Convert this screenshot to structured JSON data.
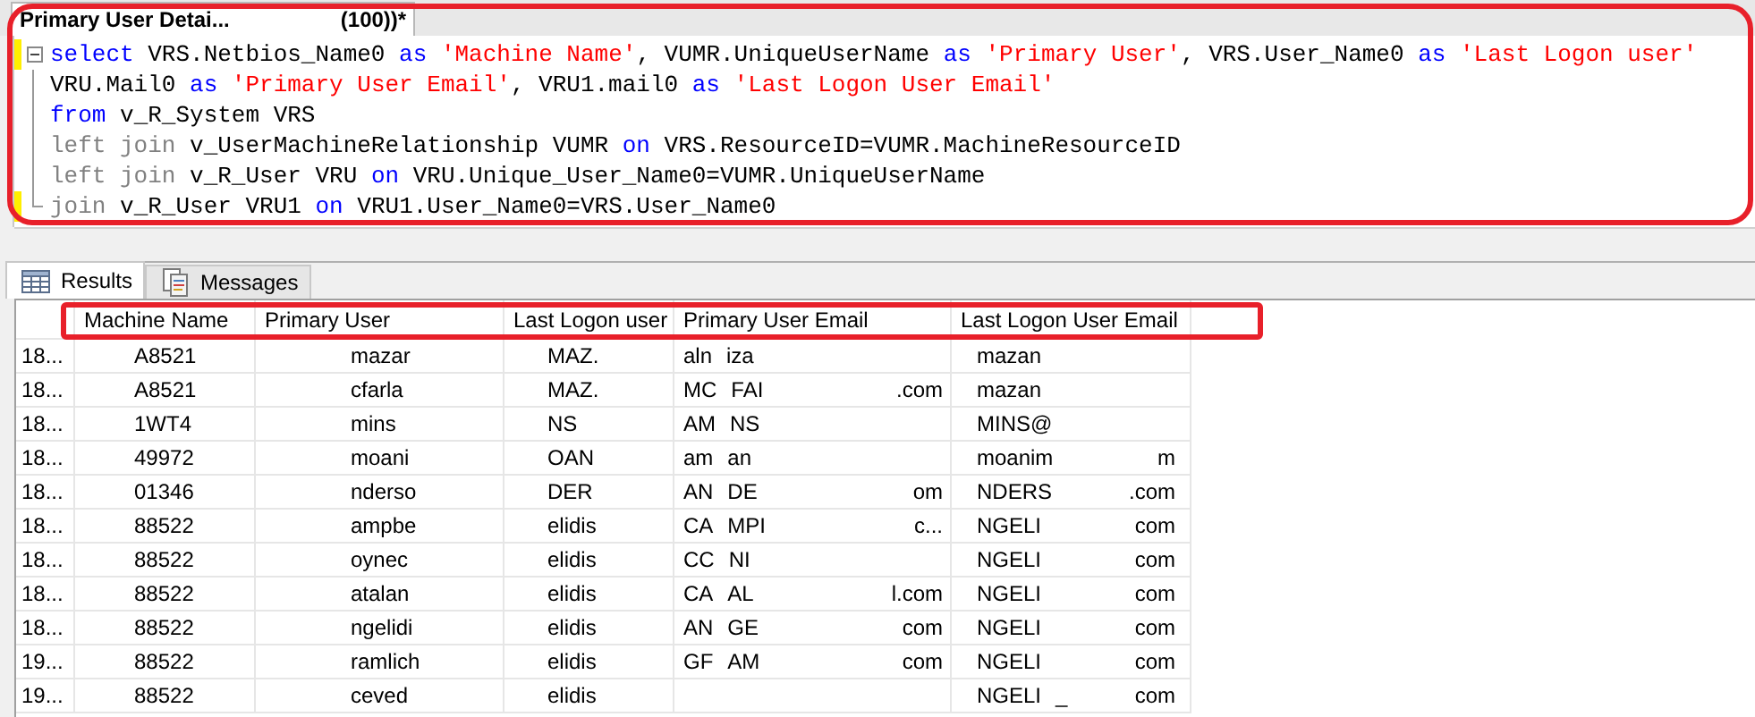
{
  "editor_tab": {
    "title": "Primary User Detai...",
    "suffix": "(100))*",
    "selected": true
  },
  "editor": {
    "lines": [
      {
        "changed": true,
        "tokens": [
          {
            "kind": "keyword",
            "text": "select"
          },
          {
            "kind": "plain",
            "text": " VRS.Netbios_Name0 "
          },
          {
            "kind": "keyword",
            "text": "as"
          },
          {
            "kind": "string",
            "text": " 'Machine Name'"
          },
          {
            "kind": "plain",
            "text": ", VUMR.UniqueUserName "
          },
          {
            "kind": "keyword",
            "text": "as"
          },
          {
            "kind": "string",
            "text": " 'Primary User'"
          },
          {
            "kind": "plain",
            "text": ", VRS.User_Name0 "
          },
          {
            "kind": "keyword",
            "text": "as"
          },
          {
            "kind": "string",
            "text": " 'Last Logon user'"
          }
        ]
      },
      {
        "changed": false,
        "tokens": [
          {
            "kind": "plain",
            "text": "VRU.Mail0 "
          },
          {
            "kind": "keyword",
            "text": "as"
          },
          {
            "kind": "string",
            "text": " 'Primary User Email'"
          },
          {
            "kind": "plain",
            "text": ", VRU1.mail0 "
          },
          {
            "kind": "keyword",
            "text": "as"
          },
          {
            "kind": "string",
            "text": " 'Last Logon User Email'"
          }
        ]
      },
      {
        "changed": false,
        "tokens": [
          {
            "kind": "keyword",
            "text": "from"
          },
          {
            "kind": "plain",
            "text": " v_R_System VRS"
          }
        ]
      },
      {
        "changed": false,
        "tokens": [
          {
            "kind": "operator",
            "text": "left join"
          },
          {
            "kind": "plain",
            "text": " v_UserMachineRelationship VUMR "
          },
          {
            "kind": "keyword",
            "text": "on"
          },
          {
            "kind": "plain",
            "text": " VRS.ResourceID=VUMR.MachineResourceID"
          }
        ]
      },
      {
        "changed": false,
        "tokens": [
          {
            "kind": "operator",
            "text": "left join"
          },
          {
            "kind": "plain",
            "text": " v_R_User VRU "
          },
          {
            "kind": "keyword",
            "text": "on"
          },
          {
            "kind": "plain",
            "text": " VRU.Unique_User_Name0=VUMR.UniqueUserName"
          }
        ]
      },
      {
        "changed": true,
        "tokens": [
          {
            "kind": "operator",
            "text": "join"
          },
          {
            "kind": "plain",
            "text": " v_R_User VRU1 "
          },
          {
            "kind": "keyword",
            "text": "on"
          },
          {
            "kind": "plain",
            "text": " VRU1.User_Name0=VRS.User_Name0"
          }
        ]
      }
    ]
  },
  "result_tabs": [
    {
      "label": "Results",
      "kind": "grid",
      "selected": true
    },
    {
      "label": "Messages",
      "kind": "messages",
      "selected": false
    }
  ],
  "grid": {
    "columns": [
      "Machine Name",
      "Primary User",
      "Last Logon user",
      "Primary User Email",
      "Last Logon User Email"
    ],
    "rows": [
      {
        "row_header": "18...",
        "cells": [
          {
            "parts": [
              "A8521"
            ]
          },
          {
            "parts": [
              "mazar"
            ]
          },
          {
            "parts": [
              "MAZ."
            ]
          },
          {
            "parts": [
              "aln",
              "iza"
            ]
          },
          {
            "parts": [
              "mazan"
            ]
          }
        ]
      },
      {
        "row_header": "18...",
        "cells": [
          {
            "parts": [
              "A8521"
            ]
          },
          {
            "parts": [
              "cfarla"
            ]
          },
          {
            "parts": [
              "MAZ."
            ]
          },
          {
            "parts": [
              "MC",
              "FAI"
            ],
            "tail": ".com"
          },
          {
            "parts": [
              "mazan"
            ]
          }
        ]
      },
      {
        "row_header": "18...",
        "cells": [
          {
            "parts": [
              "1WT4"
            ]
          },
          {
            "parts": [
              "mins"
            ]
          },
          {
            "parts": [
              "NS"
            ]
          },
          {
            "parts": [
              "AM",
              "NS"
            ]
          },
          {
            "parts": [
              "MINS@"
            ]
          }
        ]
      },
      {
        "row_header": "18...",
        "cells": [
          {
            "parts": [
              "49972"
            ]
          },
          {
            "parts": [
              "moani"
            ]
          },
          {
            "parts": [
              "OAN"
            ]
          },
          {
            "parts": [
              "am",
              "an"
            ]
          },
          {
            "parts": [
              "moanim"
            ],
            "tail": "m"
          }
        ]
      },
      {
        "row_header": "18...",
        "cells": [
          {
            "parts": [
              "01346"
            ]
          },
          {
            "parts": [
              "nderso"
            ]
          },
          {
            "parts": [
              "DER"
            ]
          },
          {
            "parts": [
              "AN",
              "DE"
            ],
            "tail": "om"
          },
          {
            "parts": [
              "NDERS"
            ],
            "tail": ".com"
          }
        ]
      },
      {
        "row_header": "18...",
        "cells": [
          {
            "parts": [
              "88522"
            ]
          },
          {
            "parts": [
              "ampbe"
            ]
          },
          {
            "parts": [
              "elidis"
            ]
          },
          {
            "parts": [
              "CA",
              "MPI"
            ],
            "tail": "c..."
          },
          {
            "parts": [
              "NGELI"
            ],
            "tail": "com"
          }
        ]
      },
      {
        "row_header": "18...",
        "cells": [
          {
            "parts": [
              "88522"
            ]
          },
          {
            "parts": [
              "oynec"
            ]
          },
          {
            "parts": [
              "elidis"
            ]
          },
          {
            "parts": [
              "CC",
              "NI"
            ]
          },
          {
            "parts": [
              "NGELI"
            ],
            "tail": "com"
          }
        ]
      },
      {
        "row_header": "18...",
        "cells": [
          {
            "parts": [
              "88522"
            ]
          },
          {
            "parts": [
              "atalan"
            ]
          },
          {
            "parts": [
              "elidis"
            ]
          },
          {
            "parts": [
              "CA",
              "AL"
            ],
            "tail": "l.com"
          },
          {
            "parts": [
              "NGELI"
            ],
            "tail": "com"
          }
        ]
      },
      {
        "row_header": "18...",
        "cells": [
          {
            "parts": [
              "88522"
            ]
          },
          {
            "parts": [
              "ngelidi"
            ]
          },
          {
            "parts": [
              "elidis"
            ]
          },
          {
            "parts": [
              "AN",
              "GE"
            ],
            "tail": "com"
          },
          {
            "parts": [
              "NGELI"
            ],
            "tail": "com"
          }
        ]
      },
      {
        "row_header": "19...",
        "cells": [
          {
            "parts": [
              "88522"
            ]
          },
          {
            "parts": [
              "ramlich"
            ]
          },
          {
            "parts": [
              "elidis"
            ]
          },
          {
            "parts": [
              "GF",
              "AM"
            ],
            "tail": "com"
          },
          {
            "parts": [
              "NGELI"
            ],
            "tail": "com"
          }
        ]
      },
      {
        "row_header": "19...",
        "cells": [
          {
            "parts": [
              "88522"
            ]
          },
          {
            "parts": [
              "ceved"
            ]
          },
          {
            "parts": [
              "elidis"
            ]
          },
          {},
          {
            "parts": [
              "NGELI",
              "_"
            ],
            "tail": "com"
          }
        ]
      }
    ]
  }
}
